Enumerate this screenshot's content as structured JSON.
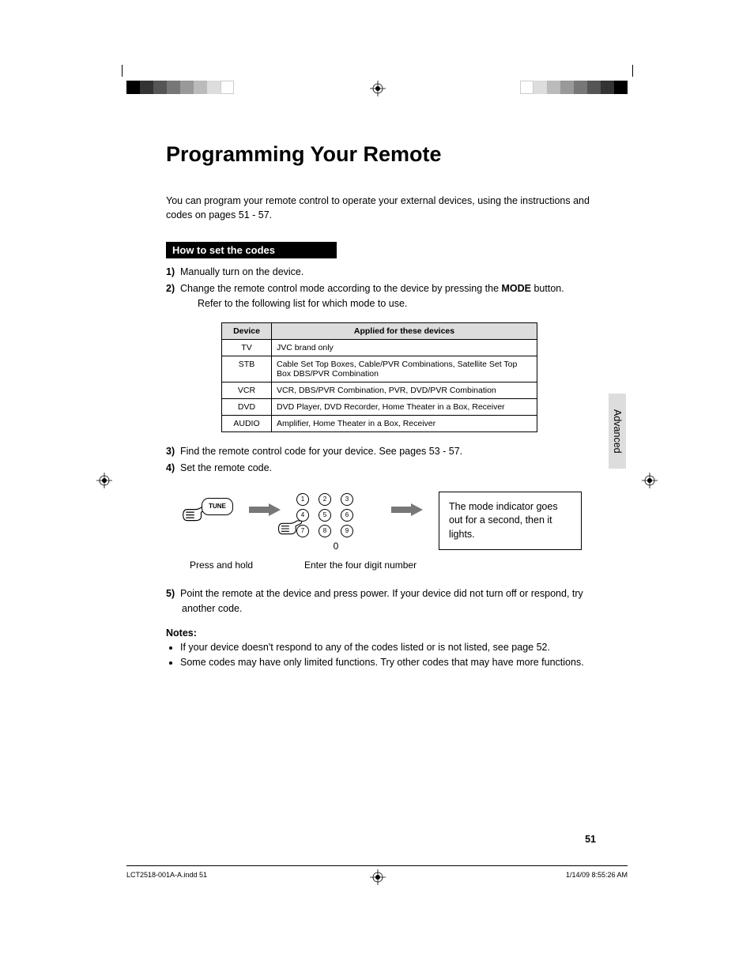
{
  "title": "Programming Your Remote",
  "intro": "You can program your remote control to operate your external devices, using the instructions and codes on pages 51 - 57.",
  "section_heading": "How to set the codes",
  "steps": {
    "s1": {
      "num": "1)",
      "text": "Manually turn on the device."
    },
    "s2": {
      "num": "2)",
      "text": "Change the remote control mode according to the device by pressing the ",
      "bold": "MODE",
      "after": " button.",
      "sub": "Refer to the following list for which mode to use."
    },
    "s3": {
      "num": "3)",
      "text": "Find the remote control code for your device.  See pages 53 - 57."
    },
    "s4": {
      "num": "4)",
      "text": "Set the remote code."
    },
    "s5": {
      "num": "5)",
      "text": "Point the remote at the device and press power.  If your device did not turn off or respond, try another code."
    }
  },
  "table": {
    "headers": {
      "device": "Device",
      "applied": "Applied for these devices"
    },
    "rows": [
      {
        "device": "TV",
        "applied": "JVC brand only"
      },
      {
        "device": "STB",
        "applied": "Cable Set Top Boxes, Cable/PVR Combinations, Satellite Set Top Box DBS/PVR Combination"
      },
      {
        "device": "VCR",
        "applied": "VCR, DBS/PVR Combination, PVR, DVD/PVR Combination"
      },
      {
        "device": "DVD",
        "applied": "DVD Player, DVD Recorder, Home Theater in a Box, Receiver"
      },
      {
        "device": "AUDIO",
        "applied": "Amplifier, Home Theater in a Box, Receiver"
      }
    ]
  },
  "diagram": {
    "tune_label": "TUNE",
    "keypad": [
      "1",
      "2",
      "3",
      "4",
      "5",
      "6",
      "7",
      "8",
      "9",
      "0"
    ],
    "result_text": "The mode indicator goes out for a second, then it lights.",
    "caption_left": "Press and hold",
    "caption_right": "Enter the four digit number"
  },
  "notes": {
    "heading": "Notes:",
    "items": [
      "If your device doesn't respond to any of the codes listed or is not listed, see page 52.",
      "Some codes may have only limited functions.  Try other codes that may have more functions."
    ]
  },
  "side_tab": "Advanced",
  "page_number": "51",
  "footer": {
    "left": "LCT2518-001A-A.indd   51",
    "right": "1/14/09   8:55:26 AM"
  }
}
